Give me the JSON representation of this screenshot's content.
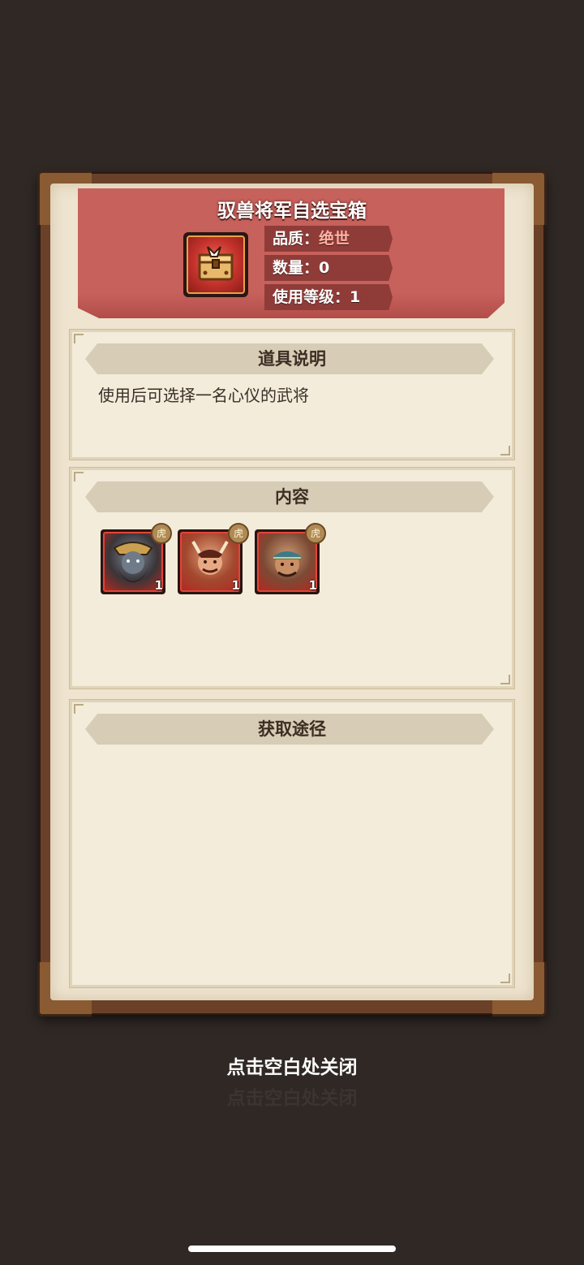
{
  "item": {
    "name": "驭兽将军自选宝箱",
    "quality_label": "品质：",
    "quality_value": "绝世",
    "quantity": "数量：0",
    "use_level": "使用等级：1",
    "icon": "treasure-chest-icon"
  },
  "sections": {
    "description": {
      "title": "道具说明",
      "text": "使用后可选择一名心仪的武将"
    },
    "contents": {
      "title": "内容",
      "heroes": [
        {
          "count": "1",
          "icon": "general-portrait-1"
        },
        {
          "count": "1",
          "icon": "general-portrait-2"
        },
        {
          "count": "1",
          "icon": "general-portrait-3"
        }
      ]
    },
    "sources": {
      "title": "获取途径"
    }
  },
  "close_hint": "点击空白处关闭",
  "colors": {
    "background": "#2f2825",
    "header_red": "#c7615c",
    "rare_quality": "#ffb2a3",
    "parchment": "#eee4cf"
  }
}
